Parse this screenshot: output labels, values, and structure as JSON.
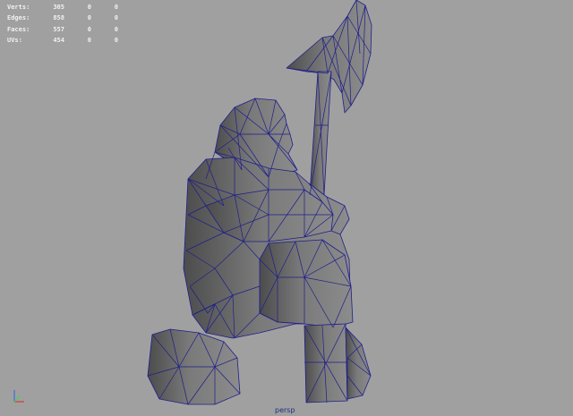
{
  "hud": {
    "rows": [
      {
        "label": "Verts:",
        "v1": "305",
        "v2": "0",
        "v3": "0"
      },
      {
        "label": "Edges:",
        "v1": "858",
        "v2": "0",
        "v3": "0"
      },
      {
        "label": "Faces:",
        "v1": "557",
        "v2": "0",
        "v3": "0"
      },
      {
        "label": "UVs:",
        "v1": "454",
        "v2": "0",
        "v3": "0"
      }
    ]
  },
  "camera": {
    "name": "persp"
  },
  "colors": {
    "background": "#a0a0a0",
    "mesh_fill": "#6f6f6f",
    "wireframe": "#1e1e8c",
    "hud_text": "#f0f0f0"
  },
  "icons": {
    "axis": "xyz-axis-gizmo-icon"
  }
}
